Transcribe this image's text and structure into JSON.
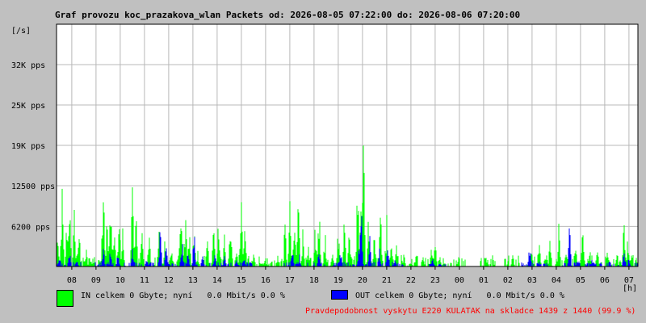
{
  "chart_data": {
    "type": "area",
    "title": "Graf provozu koc_prazakova_wlan Packets od: 2026-08-05 07:22:00 do: 2026-08-06 07:20:00",
    "ylabel": "[/s]",
    "xlabel": "[h]",
    "y_ticks": [
      {
        "value": 6200,
        "label": "6200 pps"
      },
      {
        "value": 12500,
        "label": "12500 pps"
      },
      {
        "value": 18750,
        "label": "19K pps"
      },
      {
        "value": 25000,
        "label": "25K pps"
      },
      {
        "value": 31250,
        "label": "32K pps"
      }
    ],
    "ylim": [
      0,
      37500
    ],
    "x_start_hour": 7.37,
    "x_hours_span": 24,
    "x_ticks": [
      "08",
      "09",
      "10",
      "11",
      "12",
      "13",
      "14",
      "15",
      "16",
      "17",
      "18",
      "19",
      "20",
      "21",
      "22",
      "23",
      "00",
      "01",
      "02",
      "03",
      "04",
      "05",
      "06",
      "07"
    ],
    "grid": true,
    "series": [
      {
        "name": "IN",
        "color": "#00ff00",
        "peaks": [
          [
            7.4,
            7000
          ],
          [
            7.6,
            13500
          ],
          [
            7.8,
            9000
          ],
          [
            7.9,
            14000
          ],
          [
            8.1,
            11000
          ],
          [
            8.3,
            7000
          ],
          [
            8.6,
            3000
          ],
          [
            8.9,
            1500
          ],
          [
            9.3,
            15000
          ],
          [
            9.45,
            9500
          ],
          [
            9.6,
            12000
          ],
          [
            9.75,
            8000
          ],
          [
            9.95,
            11500
          ],
          [
            10.1,
            7000
          ],
          [
            10.5,
            16500
          ],
          [
            10.65,
            9500
          ],
          [
            10.9,
            9000
          ],
          [
            11.2,
            7000
          ],
          [
            11.6,
            8500
          ],
          [
            11.85,
            5500
          ],
          [
            12.1,
            4000
          ],
          [
            12.5,
            10000
          ],
          [
            12.7,
            12000
          ],
          [
            12.85,
            6000
          ],
          [
            13.05,
            7000
          ],
          [
            13.2,
            3000
          ],
          [
            13.6,
            5000
          ],
          [
            13.85,
            10000
          ],
          [
            14.05,
            8000
          ],
          [
            14.3,
            6000
          ],
          [
            14.55,
            7500
          ],
          [
            14.8,
            4000
          ],
          [
            15.0,
            10500
          ],
          [
            15.15,
            6500
          ],
          [
            15.5,
            3000
          ],
          [
            15.8,
            1000
          ],
          [
            16.05,
            500
          ],
          [
            16.5,
            2000
          ],
          [
            16.8,
            8000
          ],
          [
            17.0,
            12000
          ],
          [
            17.2,
            9000
          ],
          [
            17.35,
            11000
          ],
          [
            17.55,
            7500
          ],
          [
            17.75,
            4000
          ],
          [
            18.05,
            8000
          ],
          [
            18.2,
            12000
          ],
          [
            18.45,
            6500
          ],
          [
            18.75,
            4000
          ],
          [
            19.0,
            7000
          ],
          [
            19.25,
            10000
          ],
          [
            19.45,
            6000
          ],
          [
            19.8,
            15500
          ],
          [
            19.95,
            12000
          ],
          [
            20.05,
            22000
          ],
          [
            20.25,
            10000
          ],
          [
            20.5,
            7500
          ],
          [
            20.75,
            9500
          ],
          [
            21.0,
            8500
          ],
          [
            21.2,
            5000
          ],
          [
            21.4,
            3500
          ],
          [
            21.7,
            2000
          ],
          [
            22.0,
            1000
          ],
          [
            22.5,
            2500
          ],
          [
            22.85,
            3500
          ],
          [
            23.0,
            4500
          ],
          [
            23.2,
            2000
          ],
          [
            23.95,
            2000
          ],
          [
            25.15,
            1500
          ],
          [
            26.2,
            2000
          ],
          [
            27.0,
            4000
          ],
          [
            27.3,
            3500
          ],
          [
            27.75,
            5000
          ],
          [
            28.1,
            7000
          ],
          [
            28.4,
            5000
          ],
          [
            28.8,
            4000
          ],
          [
            29.1,
            7500
          ],
          [
            29.4,
            3500
          ],
          [
            29.7,
            3000
          ],
          [
            30.1,
            2500
          ],
          [
            30.5,
            3000
          ],
          [
            30.8,
            8000
          ],
          [
            30.95,
            5000
          ],
          [
            31.1,
            3000
          ],
          [
            31.3,
            1500
          ]
        ]
      },
      {
        "name": "OUT",
        "color": "#0000ff",
        "peaks": [
          [
            7.5,
            1500
          ],
          [
            7.9,
            3000
          ],
          [
            8.2,
            1500
          ],
          [
            9.3,
            4000
          ],
          [
            9.6,
            3000
          ],
          [
            9.9,
            2500
          ],
          [
            10.5,
            4000
          ],
          [
            11.1,
            2000
          ],
          [
            11.65,
            6500
          ],
          [
            11.9,
            3500
          ],
          [
            12.55,
            5000
          ],
          [
            12.8,
            3000
          ],
          [
            13.05,
            6800
          ],
          [
            13.4,
            2000
          ],
          [
            13.9,
            2500
          ],
          [
            14.3,
            2000
          ],
          [
            14.8,
            1500
          ],
          [
            15.1,
            2000
          ],
          [
            17.1,
            3500
          ],
          [
            17.4,
            2000
          ],
          [
            18.2,
            2500
          ],
          [
            19.1,
            3000
          ],
          [
            19.85,
            3500
          ],
          [
            19.95,
            10500
          ],
          [
            20.3,
            5000
          ],
          [
            20.7,
            3500
          ],
          [
            21.05,
            5000
          ],
          [
            21.35,
            1500
          ],
          [
            22.9,
            1500
          ],
          [
            23.2,
            800
          ],
          [
            26.9,
            4000
          ],
          [
            27.3,
            1000
          ],
          [
            28.55,
            7000
          ],
          [
            28.9,
            1500
          ],
          [
            29.5,
            1500
          ],
          [
            30.2,
            1000
          ],
          [
            30.8,
            3500
          ],
          [
            31.0,
            1500
          ]
        ]
      }
    ]
  },
  "legend": {
    "in_label": "IN celkem 0 Gbyte; nyní   0.0 Mbit/s 0.0 %",
    "out_label": "OUT celkem 0 Gbyte; nyní   0.0 Mbit/s 0.0 %",
    "in_color": "#00ff00",
    "out_color": "#0000ff"
  },
  "footer": {
    "note": "Pravdepodobnost vyskytu E220 KULATAK na skladce 1439 z 1440 (99.9 %)",
    "color": "#ff0000"
  }
}
